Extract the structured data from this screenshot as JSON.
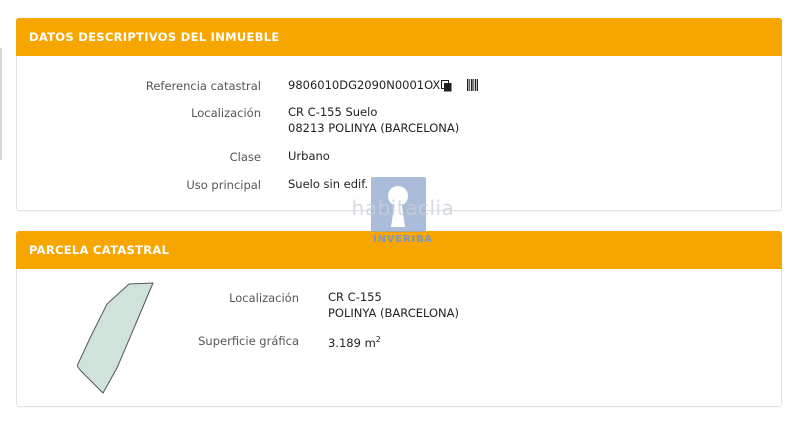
{
  "colors": {
    "header_bg": "#f7a600",
    "header_text": "#ffffff",
    "parcel_fill": "#cfe3da",
    "parcel_stroke": "#555555"
  },
  "datos": {
    "title": "DATOS DESCRIPTIVOS DEL INMUEBLE",
    "ref_label": "Referencia catastral",
    "ref_value": "9806010DG2090N0001OX",
    "loc_label": "Localización",
    "loc_line1": "CR C-155 Suelo",
    "loc_line2": "08213 POLINYA (BARCELONA)",
    "clase_label": "Clase",
    "clase_value": "Urbano",
    "uso_label": "Uso principal",
    "uso_value": "Suelo sin edif.",
    "icons": [
      "copy-icon",
      "barcode-icon"
    ]
  },
  "parcela": {
    "title": "PARCELA CATASTRAL",
    "loc_label": "Localización",
    "loc_line1": "CR C-155",
    "loc_line2": "POLINYA (BARCELONA)",
    "sup_label": "Superficie gráfica",
    "sup_value": "3.189 m",
    "sup_unit_exp": "2"
  },
  "watermark": {
    "brand": "habitaclia",
    "agency": "INVERIBA",
    "icon": "keyhole-icon"
  }
}
